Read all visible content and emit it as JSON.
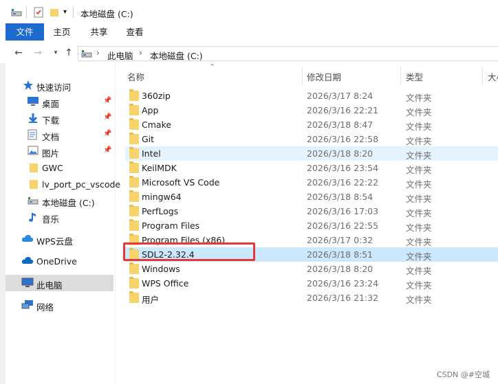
{
  "title": "本地磁盘 (C:)",
  "ribbon": {
    "tabs": [
      "文件",
      "主页",
      "共享",
      "查看"
    ]
  },
  "address": {
    "crumbs": [
      "此电脑",
      "本地磁盘 (C:)"
    ]
  },
  "columns": {
    "name": "名称",
    "date": "修改日期",
    "type": "类型",
    "size": "大小"
  },
  "nav": [
    {
      "label": "快速访问",
      "icon": "star-icon"
    },
    {
      "label": "桌面",
      "icon": "desktop-icon",
      "pinned": true
    },
    {
      "label": "下载",
      "icon": "download-icon",
      "pinned": true
    },
    {
      "label": "文档",
      "icon": "document-icon",
      "pinned": true
    },
    {
      "label": "图片",
      "icon": "picture-icon",
      "pinned": true
    },
    {
      "label": "GWC",
      "icon": "folder-icon"
    },
    {
      "label": "lv_port_pc_vscode",
      "icon": "folder-icon"
    },
    {
      "label": "本地磁盘 (C:)",
      "icon": "drive-icon"
    },
    {
      "label": "音乐",
      "icon": "music-icon"
    },
    {
      "label": "WPS云盘",
      "icon": "cloud-icon"
    },
    {
      "label": "OneDrive",
      "icon": "cloud-icon"
    },
    {
      "label": "此电脑",
      "icon": "computer-icon",
      "selected": true
    },
    {
      "label": "网络",
      "icon": "network-icon"
    }
  ],
  "files": [
    {
      "name": "360zip",
      "date": "2026/3/17 8:24",
      "type": "文件夹"
    },
    {
      "name": "App",
      "date": "2026/3/16 22:21",
      "type": "文件夹"
    },
    {
      "name": "Cmake",
      "date": "2026/3/18 8:47",
      "type": "文件夹"
    },
    {
      "name": "Git",
      "date": "2026/3/16 22:58",
      "type": "文件夹"
    },
    {
      "name": "Intel",
      "date": "2026/3/18 8:20",
      "type": "文件夹",
      "hover": true
    },
    {
      "name": "KeilMDK",
      "date": "2026/3/16 23:54",
      "type": "文件夹"
    },
    {
      "name": "Microsoft VS Code",
      "date": "2026/3/16 22:22",
      "type": "文件夹"
    },
    {
      "name": "mingw64",
      "date": "2026/3/18 8:54",
      "type": "文件夹"
    },
    {
      "name": "PerfLogs",
      "date": "2026/3/16 17:03",
      "type": "文件夹"
    },
    {
      "name": "Program Files",
      "date": "2026/3/16 22:55",
      "type": "文件夹"
    },
    {
      "name": "Program Files (x86)",
      "date": "2026/3/17 0:32",
      "type": "文件夹"
    },
    {
      "name": "SDL2-2.32.4",
      "date": "2026/3/18 8:51",
      "type": "文件夹",
      "selected": true
    },
    {
      "name": "Windows",
      "date": "2026/3/18 8:20",
      "type": "文件夹"
    },
    {
      "name": "WPS Office",
      "date": "2026/3/16 23:24",
      "type": "文件夹"
    },
    {
      "name": "用户",
      "date": "2026/3/16 21:32",
      "type": "文件夹"
    }
  ],
  "watermark": "CSDN @#空城",
  "colors": {
    "accent": "#1e6bd0",
    "selection": "#cce8ff",
    "hover": "#e5f3ff",
    "highlight_box": "#e53838",
    "folder": "#f7d46b"
  }
}
